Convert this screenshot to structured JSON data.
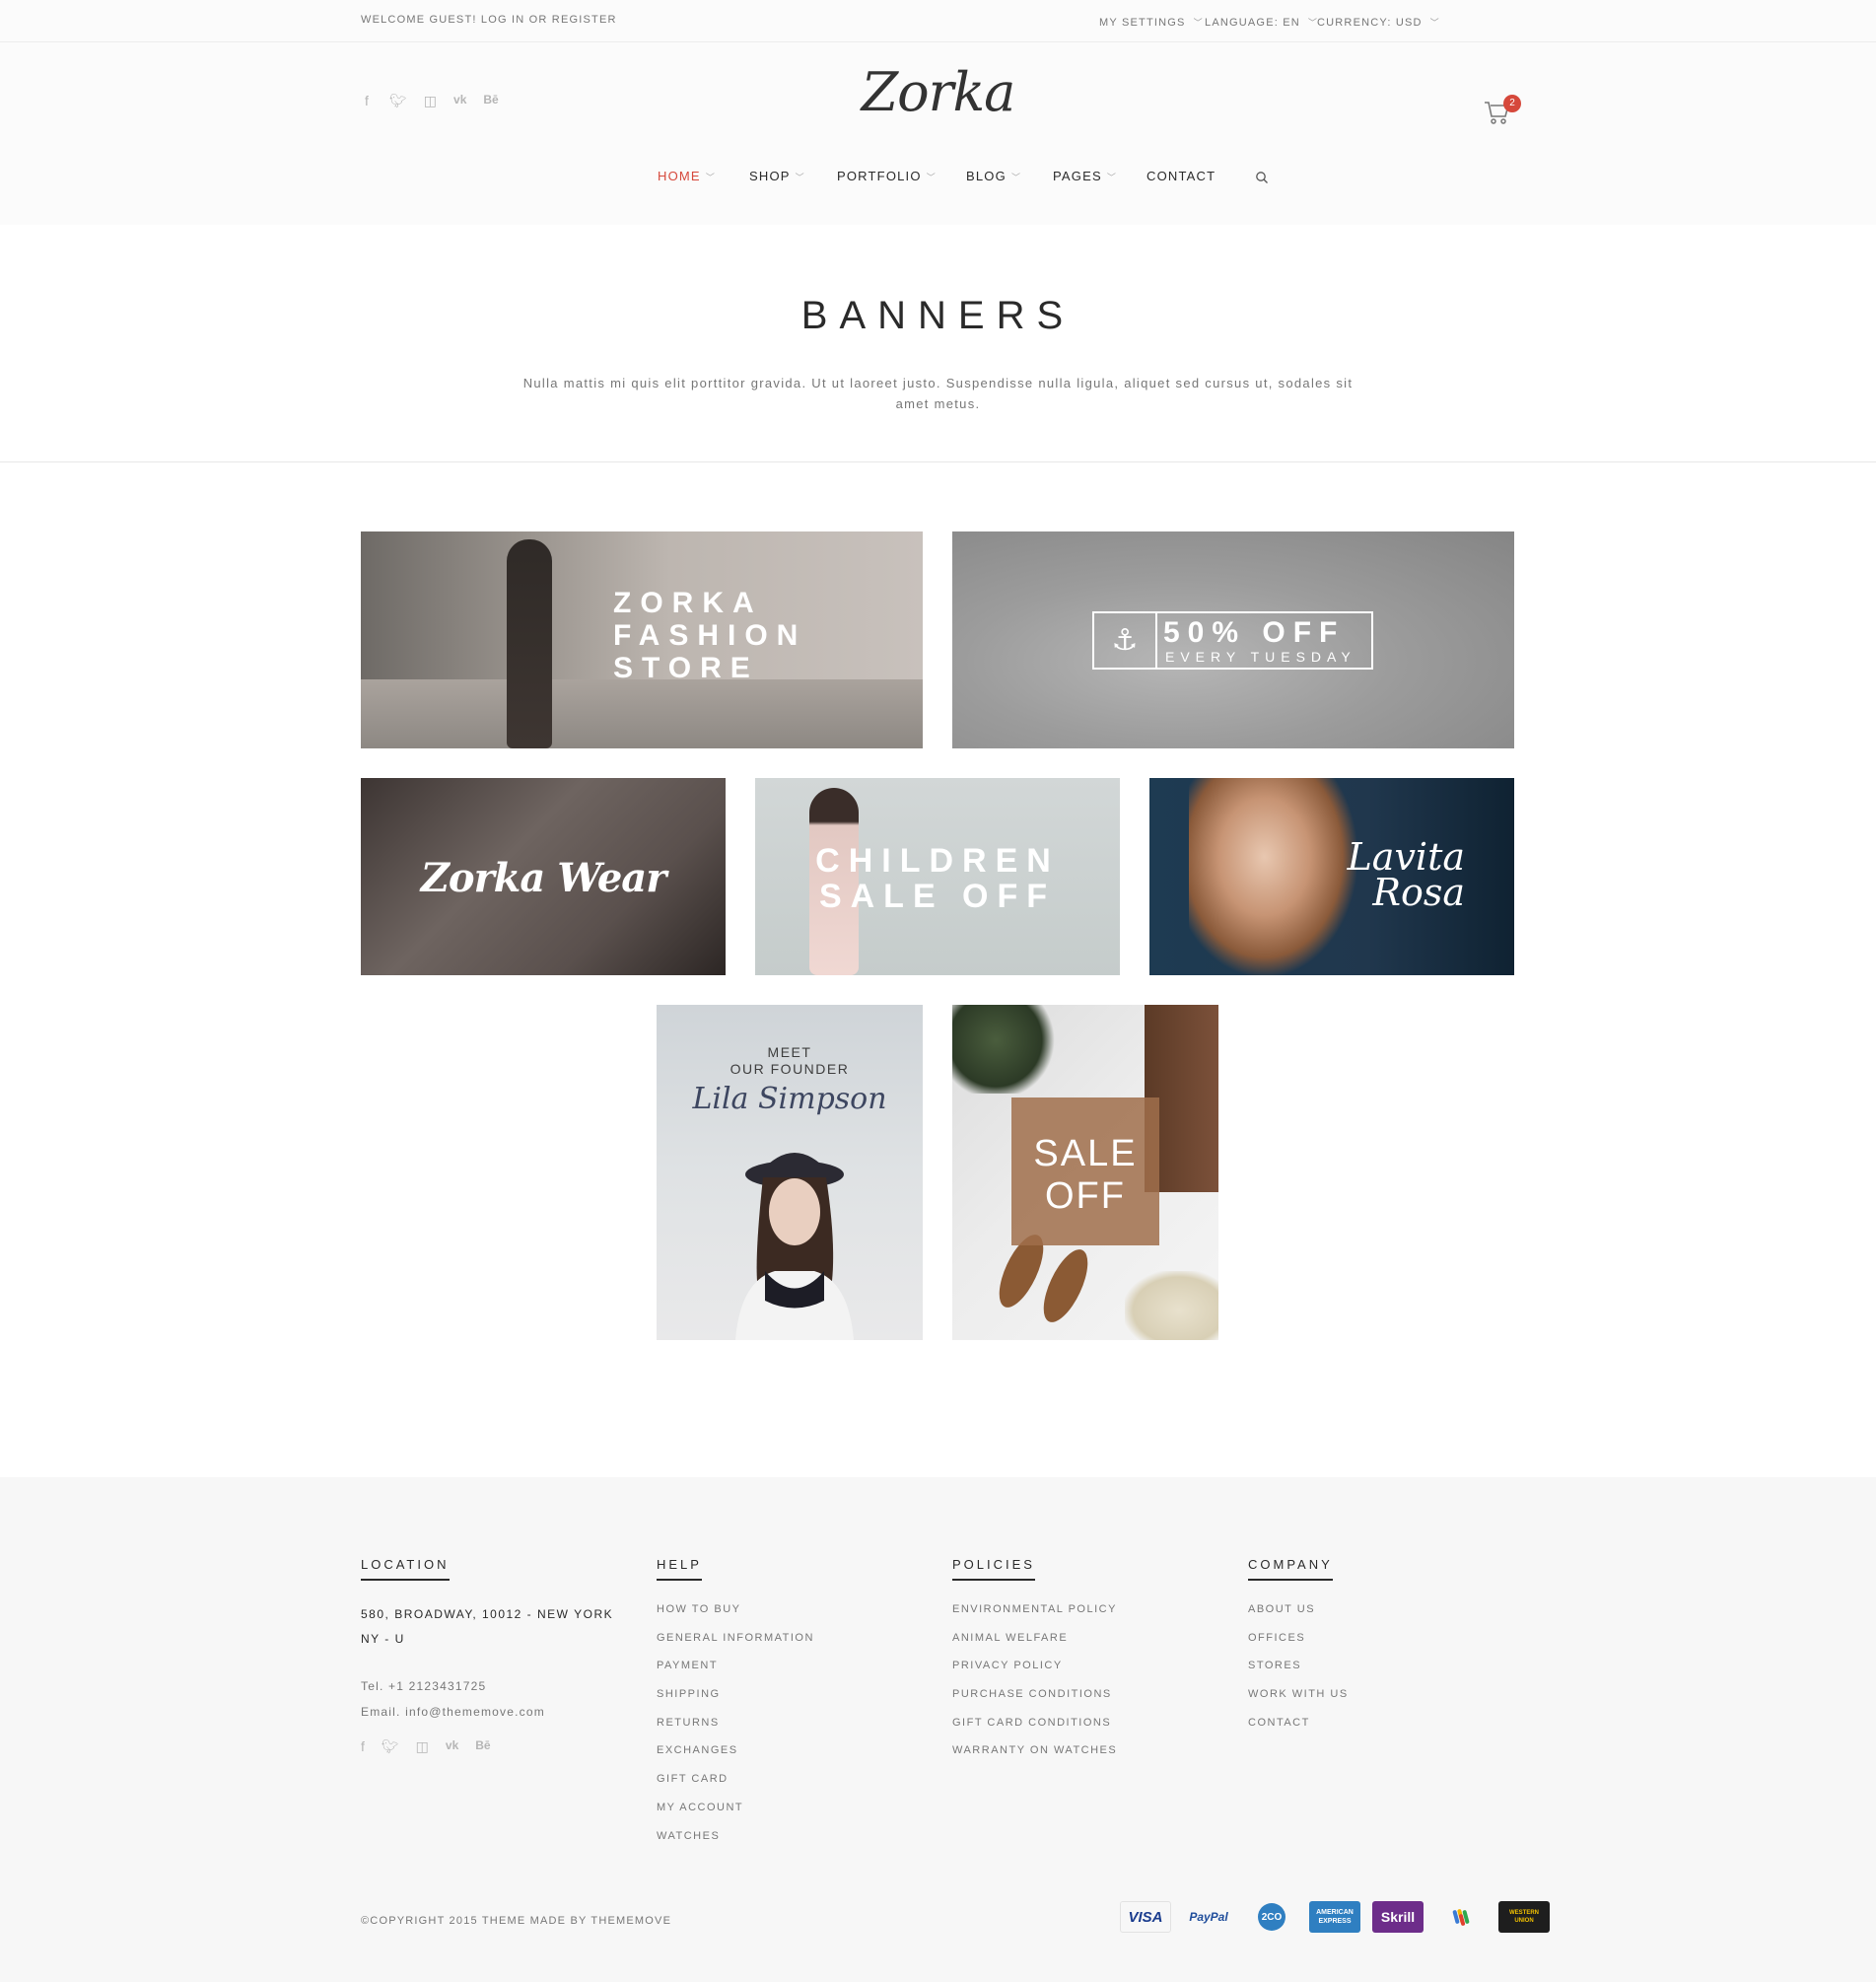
{
  "topbar": {
    "welcome": "WELCOME GUEST! LOG IN OR REGISTER",
    "settings": "MY SETTINGS",
    "language": "LANGUAGE: EN",
    "currency": "CURRENCY: USD"
  },
  "header": {
    "logo": "Zorka",
    "cart_count": "2",
    "social_icons": [
      "facebook-icon",
      "twitter-icon",
      "instagram-icon",
      "vk-icon",
      "behance-icon"
    ]
  },
  "nav": {
    "items": [
      {
        "label": "HOME",
        "active": true,
        "has_dropdown": true
      },
      {
        "label": "SHOP",
        "has_dropdown": true
      },
      {
        "label": "PORTFOLIO",
        "has_dropdown": true
      },
      {
        "label": "BLOG",
        "has_dropdown": true
      },
      {
        "label": "PAGES",
        "has_dropdown": true
      },
      {
        "label": "CONTACT",
        "has_dropdown": false
      }
    ]
  },
  "page": {
    "title": "BANNERS",
    "description": "Nulla mattis mi quis elit porttitor gravida. Ut ut laoreet justo. Suspendisse nulla ligula, aliquet sed cursus ut, sodales sit amet metus."
  },
  "banners": {
    "fashion_store": {
      "line1": "ZORKA",
      "line2": "FASHION",
      "line3": "STORE"
    },
    "tuesday": {
      "title": "50% OFF",
      "subtitle": "EVERY TUESDAY"
    },
    "wear": {
      "title": "Zorka Wear"
    },
    "children": {
      "line1": "CHILDREN",
      "line2": "SALE OFF"
    },
    "lavita": {
      "line1": "Lavita",
      "line2": "Rosa"
    },
    "founder": {
      "line1": "MEET",
      "line2": "OUR FOUNDER",
      "name": "Lila Simpson"
    },
    "sale": {
      "line1": "SALE",
      "line2": "OFF"
    }
  },
  "footer": {
    "location": {
      "heading": "LOCATION",
      "address": "580, BROADWAY, 10012 - NEW YORK NY - U",
      "tel": "Tel. +1 2123431725",
      "email": "Email. info@thememove.com"
    },
    "help": {
      "heading": "HELP",
      "links": [
        "HOW TO BUY",
        "GENERAL INFORMATION",
        "PAYMENT",
        "SHIPPING",
        "RETURNS",
        "EXCHANGES",
        "GIFT CARD",
        "MY ACCOUNT",
        "WATCHES"
      ]
    },
    "policies": {
      "heading": "POLICIES",
      "links": [
        "ENVIRONMENTAL POLICY",
        "ANIMAL WELFARE",
        "PRIVACY POLICY",
        "PURCHASE CONDITIONS",
        "GIFT CARD CONDITIONS",
        "WARRANTY ON WATCHES"
      ]
    },
    "company": {
      "heading": "COMPANY",
      "links": [
        "ABOUT US",
        "OFFICES",
        "STORES",
        "WORK WITH US",
        "CONTACT"
      ]
    },
    "copyright": "©COPYRIGHT 2015 THEME MADE BY THEMEMOVE",
    "payments": [
      {
        "name": "visa",
        "label": "VISA",
        "bg": "#ffffff",
        "fg": "#1a3c8e"
      },
      {
        "name": "paypal",
        "label": "PayPal",
        "bg": "#ffffff",
        "fg": "#1f4d9b"
      },
      {
        "name": "2co",
        "label": "2CO",
        "bg": "#ffffff",
        "fg": "#2f7fc1"
      },
      {
        "name": "amex",
        "label": "AMERICAN EXPRESS",
        "bg": "#2f7fc1",
        "fg": "#ffffff"
      },
      {
        "name": "skrill",
        "label": "Skrill",
        "bg": "#6d2d8a",
        "fg": "#ffffff"
      },
      {
        "name": "google-wallet",
        "label": "",
        "bg": "#ffffff",
        "fg": "#333333"
      },
      {
        "name": "western-union",
        "label": "WESTERN UNION",
        "bg": "#1e1e1e",
        "fg": "#f2c100"
      }
    ]
  },
  "colors": {
    "accent": "#d6483b",
    "text": "#2a2a2a",
    "muted": "#777777",
    "footer_bg": "#f7f7f7"
  }
}
